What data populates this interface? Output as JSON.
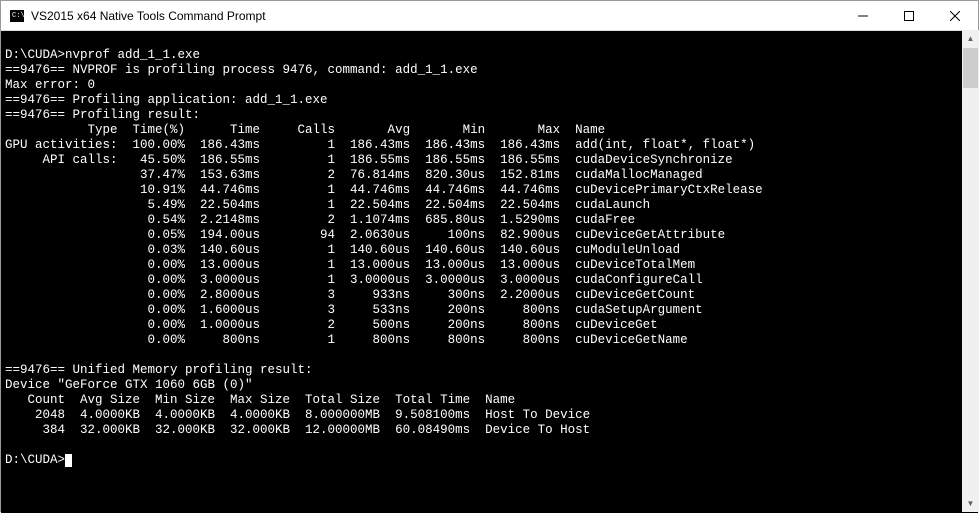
{
  "window": {
    "title": "VS2015 x64 Native Tools Command Prompt"
  },
  "session": {
    "cwd": "D:\\CUDA",
    "command": "nvprof add_1_1.exe",
    "pid": "9476",
    "profiled_command": "add_1_1.exe",
    "max_error": "Max error: 0",
    "line_profiling_process": "==9476== NVPROF is profiling process 9476, command: add_1_1.exe",
    "line_profiling_app": "==9476== Profiling application: add_1_1.exe",
    "line_profiling_result": "==9476== Profiling result:",
    "line_unified_header": "==9476== Unified Memory profiling result:",
    "device_line": "Device \"GeForce GTX 1060 6GB (0)\""
  },
  "profiling_header": {
    "c0": "Type",
    "c1": "Time(%)",
    "c2": "Time",
    "c3": "Calls",
    "c4": "Avg",
    "c5": "Min",
    "c6": "Max",
    "c7": "Name"
  },
  "rows": [
    {
      "type": "GPU activities:",
      "pct": "100.00%",
      "time": "186.43ms",
      "calls": "1",
      "avg": "186.43ms",
      "min": "186.43ms",
      "max": "186.43ms",
      "name": "add(int, float*, float*)"
    },
    {
      "type": "API calls:",
      "pct": "45.50%",
      "time": "186.55ms",
      "calls": "1",
      "avg": "186.55ms",
      "min": "186.55ms",
      "max": "186.55ms",
      "name": "cudaDeviceSynchronize"
    },
    {
      "type": "",
      "pct": "37.47%",
      "time": "153.63ms",
      "calls": "2",
      "avg": "76.814ms",
      "min": "820.30us",
      "max": "152.81ms",
      "name": "cudaMallocManaged"
    },
    {
      "type": "",
      "pct": "10.91%",
      "time": "44.746ms",
      "calls": "1",
      "avg": "44.746ms",
      "min": "44.746ms",
      "max": "44.746ms",
      "name": "cuDevicePrimaryCtxRelease"
    },
    {
      "type": "",
      "pct": "5.49%",
      "time": "22.504ms",
      "calls": "1",
      "avg": "22.504ms",
      "min": "22.504ms",
      "max": "22.504ms",
      "name": "cudaLaunch"
    },
    {
      "type": "",
      "pct": "0.54%",
      "time": "2.2148ms",
      "calls": "2",
      "avg": "1.1074ms",
      "min": "685.80us",
      "max": "1.5290ms",
      "name": "cudaFree"
    },
    {
      "type": "",
      "pct": "0.05%",
      "time": "194.00us",
      "calls": "94",
      "avg": "2.0630us",
      "min": "100ns",
      "max": "82.900us",
      "name": "cuDeviceGetAttribute"
    },
    {
      "type": "",
      "pct": "0.03%",
      "time": "140.60us",
      "calls": "1",
      "avg": "140.60us",
      "min": "140.60us",
      "max": "140.60us",
      "name": "cuModuleUnload"
    },
    {
      "type": "",
      "pct": "0.00%",
      "time": "13.000us",
      "calls": "1",
      "avg": "13.000us",
      "min": "13.000us",
      "max": "13.000us",
      "name": "cuDeviceTotalMem"
    },
    {
      "type": "",
      "pct": "0.00%",
      "time": "3.0000us",
      "calls": "1",
      "avg": "3.0000us",
      "min": "3.0000us",
      "max": "3.0000us",
      "name": "cudaConfigureCall"
    },
    {
      "type": "",
      "pct": "0.00%",
      "time": "2.8000us",
      "calls": "3",
      "avg": "933ns",
      "min": "300ns",
      "max": "2.2000us",
      "name": "cuDeviceGetCount"
    },
    {
      "type": "",
      "pct": "0.00%",
      "time": "1.6000us",
      "calls": "3",
      "avg": "533ns",
      "min": "200ns",
      "max": "800ns",
      "name": "cudaSetupArgument"
    },
    {
      "type": "",
      "pct": "0.00%",
      "time": "1.0000us",
      "calls": "2",
      "avg": "500ns",
      "min": "200ns",
      "max": "800ns",
      "name": "cuDeviceGet"
    },
    {
      "type": "",
      "pct": "0.00%",
      "time": "800ns",
      "calls": "1",
      "avg": "800ns",
      "min": "800ns",
      "max": "800ns",
      "name": "cuDeviceGetName"
    }
  ],
  "um_header": {
    "c0": "Count",
    "c1": "Avg Size",
    "c2": "Min Size",
    "c3": "Max Size",
    "c4": "Total Size",
    "c5": "Total Time",
    "c6": "Name"
  },
  "um_rows": [
    {
      "count": "2048",
      "avg": "4.0000KB",
      "min": "4.0000KB",
      "max": "4.0000KB",
      "total": "8.000000MB",
      "time": "9.508100ms",
      "name": "Host To Device"
    },
    {
      "count": "384",
      "avg": "32.000KB",
      "min": "32.000KB",
      "max": "32.000KB",
      "total": "12.00000MB",
      "time": "60.08490ms",
      "name": "Device To Host"
    }
  ],
  "prompt": {
    "text": "D:\\CUDA>"
  }
}
